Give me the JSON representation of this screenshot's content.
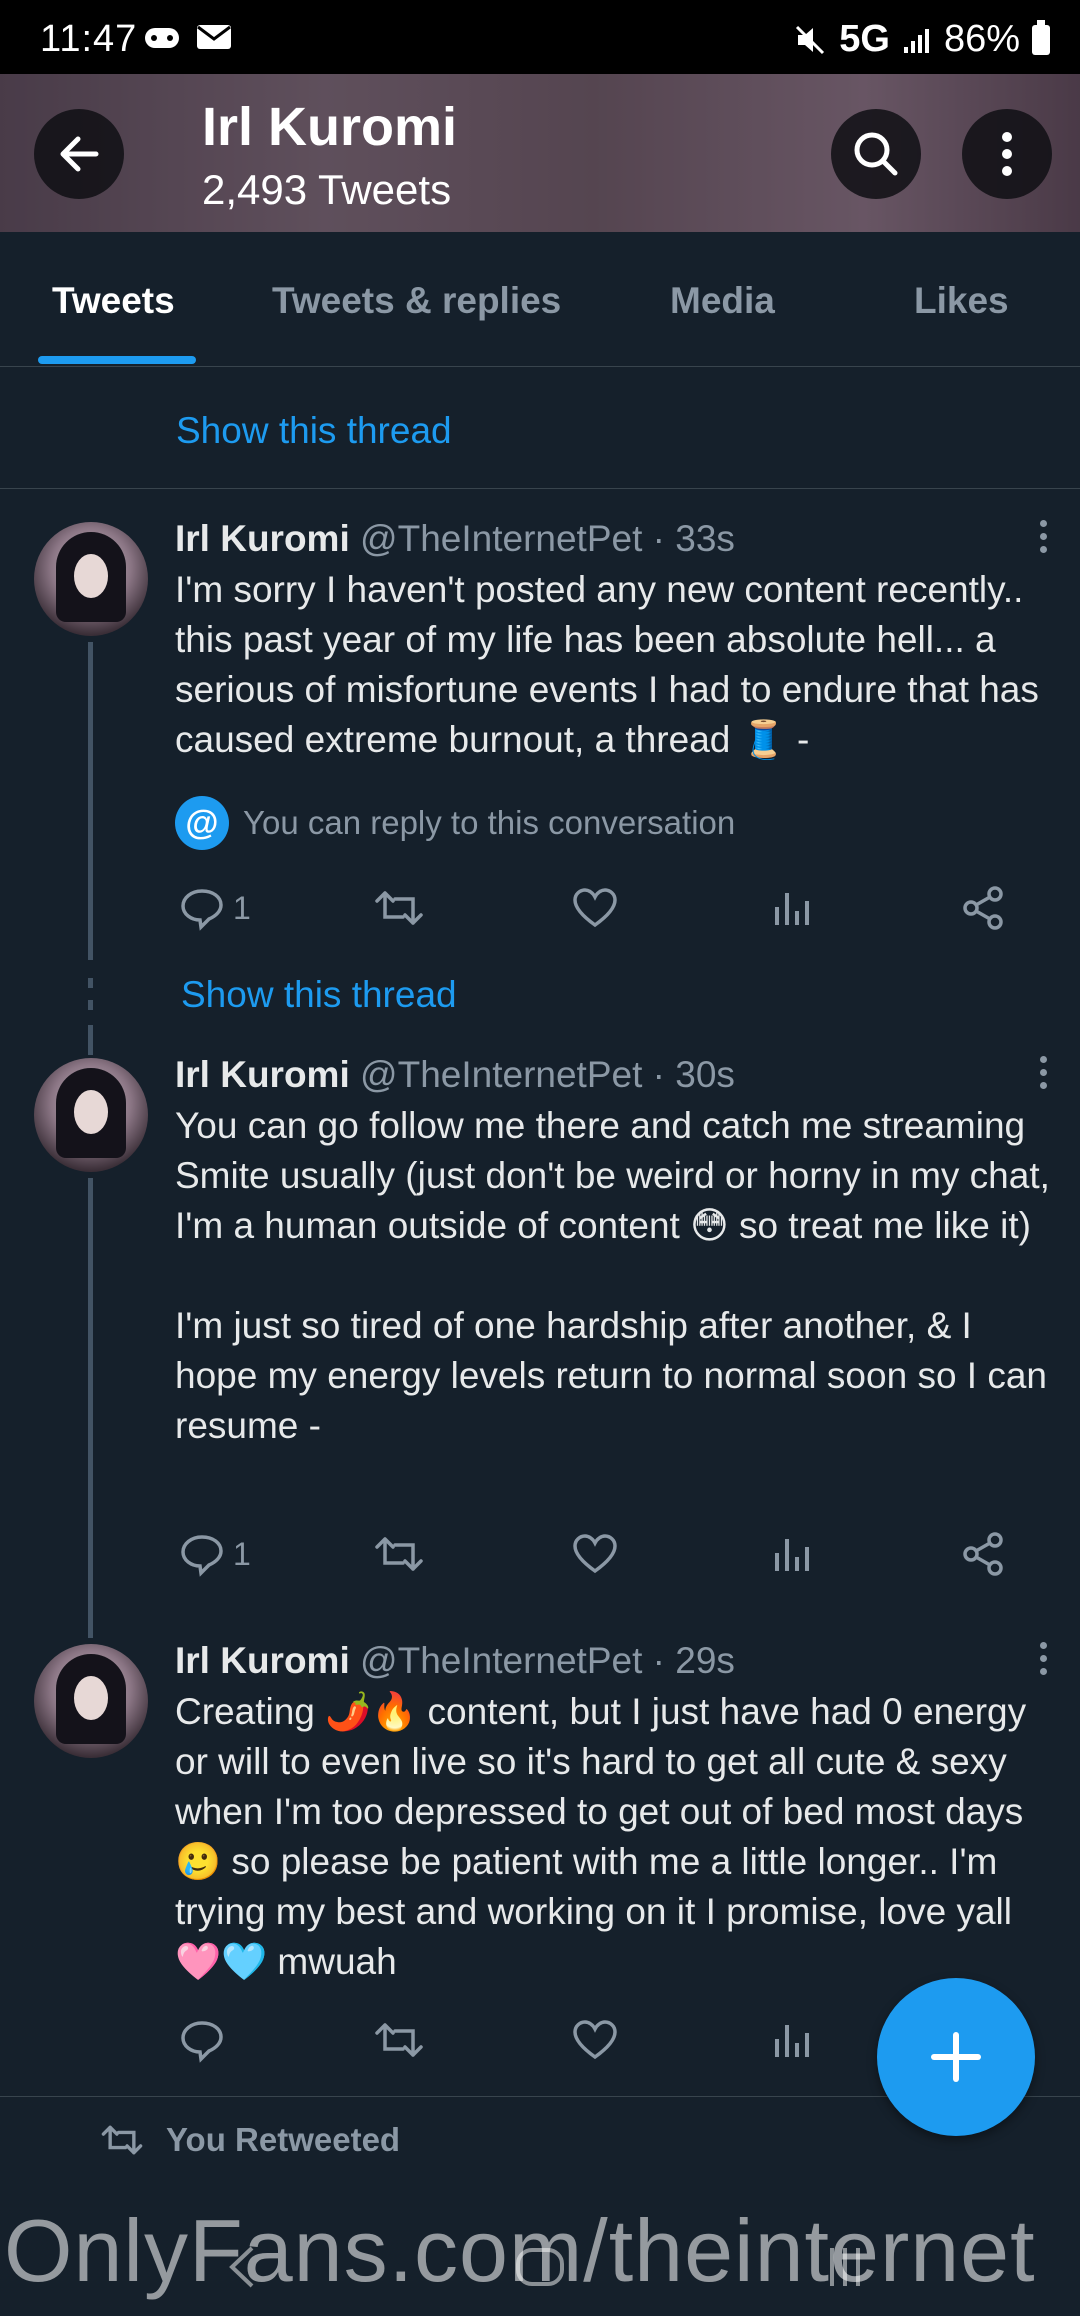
{
  "status_bar": {
    "time": "11:47",
    "network": "5G",
    "battery": "86%"
  },
  "header": {
    "title": "Irl Kuromi",
    "subtitle": "2,493 Tweets"
  },
  "tabs": [
    {
      "label": "Tweets",
      "active": true
    },
    {
      "label": "Tweets & replies",
      "active": false
    },
    {
      "label": "Media",
      "active": false
    },
    {
      "label": "Likes",
      "active": false
    }
  ],
  "show_thread_label": "Show this thread",
  "tweets": [
    {
      "name": "Irl Kuromi",
      "handle": "@TheInternetPet",
      "time": "· 33s",
      "text": "I'm sorry I haven't posted any new content recently.. this past year of my life has been absolute hell... a serious of misfortune events I had to endure that has caused extreme burnout, a thread 🧵 -",
      "reply_note": "You can reply to this conversation",
      "reply_count": "1"
    },
    {
      "name": "Irl Kuromi",
      "handle": "@TheInternetPet",
      "time": "· 30s",
      "text": "You can go follow me there and catch me streaming Smite usually (just don't be weird or horny in my chat, I'm a human outside of content 😳 so treat me like it)\n\nI'm just so tired of one hardship after another, & I hope my energy levels return to normal soon so I can resume -",
      "reply_count": "1"
    },
    {
      "name": "Irl Kuromi",
      "handle": "@TheInternetPet",
      "time": "· 29s",
      "text": "Creating 🌶️🔥 content, but I just have had 0 energy or will to even live so it's hard to get all cute & sexy when I'm too depressed to get out of bed most days 🥲 so please be patient with me a little longer.. I'm trying my best and working on it I promise, love yall 🩷🩵 mwuah",
      "reply_count": ""
    }
  ],
  "retweeted_label": "You Retweeted",
  "watermark": "OnlyFans.com/theinternet",
  "colors": {
    "background": "#15202b",
    "accent": "#1d9bf0",
    "muted": "#8b98a5"
  }
}
